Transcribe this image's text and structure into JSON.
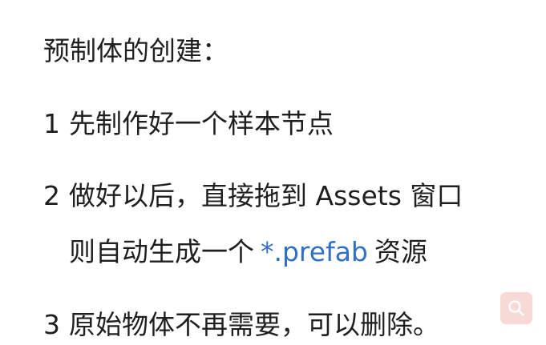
{
  "document": {
    "title": "预制体的创建：",
    "step1": {
      "num": "1",
      "text": "先制作好一个样本节点"
    },
    "step2": {
      "num": "2",
      "text": "做好以后，直接拖到 Assets 窗口",
      "cont_before": "则自动生成一个",
      "code": "*.prefab",
      "cont_after": "资源"
    },
    "step3": {
      "num": "3",
      "text": "原始物体不再需要，可以删除。"
    }
  },
  "colors": {
    "text": "#1f1f1f",
    "code": "#2f6fc8",
    "search_button_bg": "#f7d9d6"
  },
  "icons": {
    "search": "search-icon"
  }
}
